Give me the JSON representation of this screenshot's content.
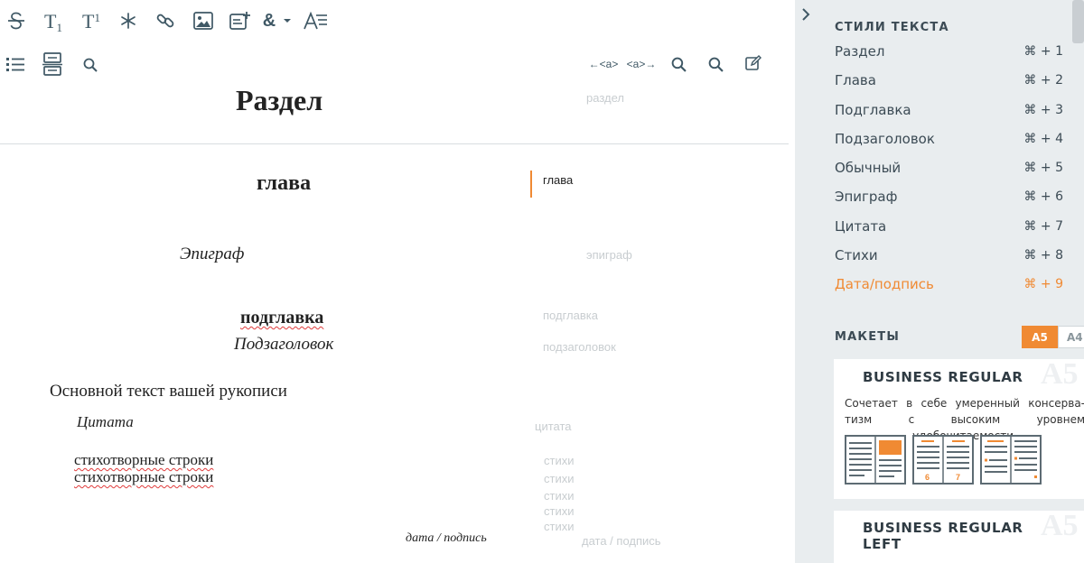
{
  "toolbar": {
    "subscript_label": "T",
    "subscript_mark": "1",
    "superscript_label": "T",
    "superscript_mark": "1",
    "ampersand": "&",
    "prev_link": "←<a>",
    "next_link": "<a>→"
  },
  "document": {
    "section": "Раздел",
    "chapter": "глава",
    "epigraph": "Эпиграф",
    "subchapter": "подглавка",
    "subheading": "Подзаголовок",
    "body": "Основной текст вашей рукописи",
    "quote": "Цитата",
    "verse_1": "стихотворные строки",
    "verse_2": "стихотворные строки",
    "signature": "дата / подпись"
  },
  "labels": {
    "section": "раздел",
    "chapter": "глава",
    "epigraph": "эпиграф",
    "subchapter": "подглавка",
    "subheading": "подзаголовок",
    "quote": "цитата",
    "verse": [
      "стихи",
      "стихи",
      "стихи",
      "стихи",
      "стихи"
    ],
    "signature": "дата / подпись"
  },
  "panel": {
    "styles_title": "СТИЛИ ТЕКСТА",
    "styles": [
      {
        "label": "Раздел",
        "key": "⌘ + 1"
      },
      {
        "label": "Глава",
        "key": "⌘ + 2"
      },
      {
        "label": "Подглавка",
        "key": "⌘ + 3"
      },
      {
        "label": "Подзаголовок",
        "key": "⌘ + 4"
      },
      {
        "label": "Обычный",
        "key": "⌘ + 5"
      },
      {
        "label": "Эпиграф",
        "key": "⌘ + 6"
      },
      {
        "label": "Цитата",
        "key": "⌘ + 7"
      },
      {
        "label": "Стихи",
        "key": "⌘ + 8"
      },
      {
        "label": "Дата/подпись",
        "key": "⌘ + 9"
      }
    ],
    "active_style_index": 8,
    "layouts_title": "МАКЕТЫ",
    "tab_a5": "A5",
    "tab_a4": "A4",
    "cards": [
      {
        "name": "BUSINESS REGULAR",
        "watermark": "A5",
        "description": "Сочетает в себе умеренный консерва-тизм с высоким уровнем удобочитаемости.",
        "page_numbers": [
          "6",
          "7"
        ]
      },
      {
        "name": "BUSINESS REGULAR LEFT",
        "watermark": "A5"
      }
    ]
  },
  "colors": {
    "accent": "#f08a33",
    "icon": "#3f5865",
    "panel_bg": "#e9edef",
    "label_muted": "#c8cdd0",
    "spellcheck": "#e03b3b"
  }
}
